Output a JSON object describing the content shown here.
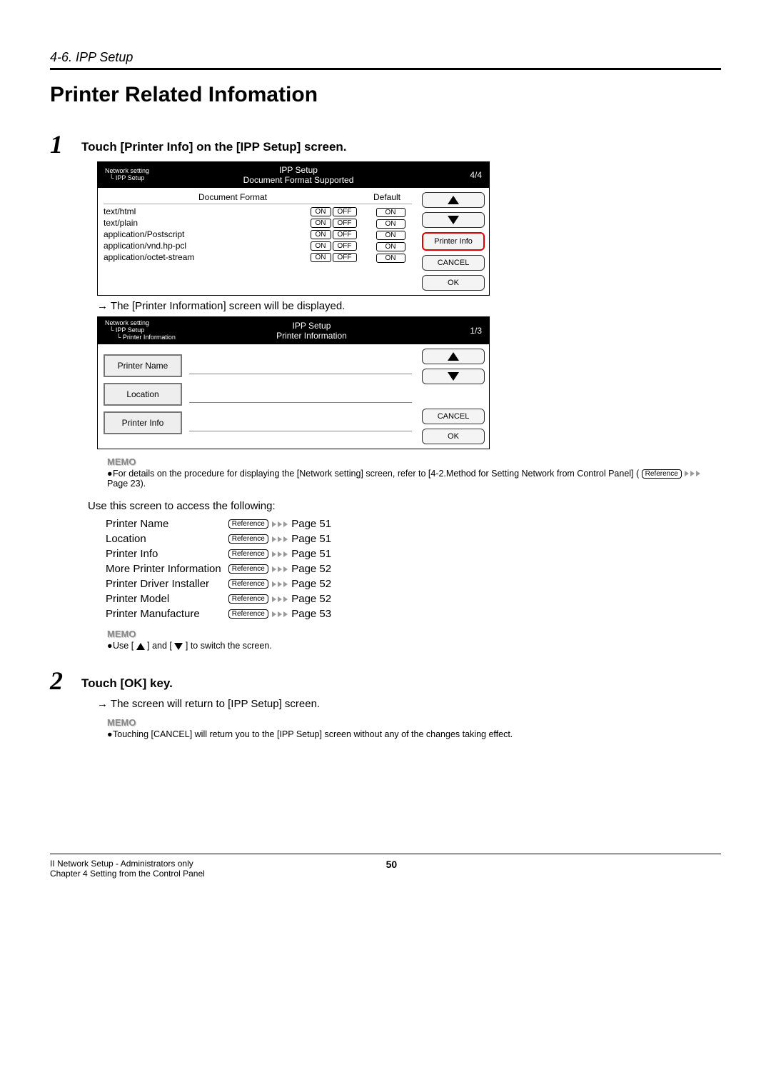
{
  "header": {
    "section": "4-6. IPP Setup"
  },
  "title": "Printer Related Infomation",
  "step1": {
    "num": "1",
    "head": "Touch [Printer Info] on the [IPP Setup] screen.",
    "result": "The [Printer Information] screen will be displayed."
  },
  "screenA": {
    "crumb1": "Network setting",
    "crumb2": "IPP Setup",
    "title1": "IPP Setup",
    "title2": "Document Format Supported",
    "page": "4/4",
    "col1": "Document Format",
    "col2": "Default",
    "rows": [
      {
        "label": "text/html",
        "on": "ON",
        "off": "OFF",
        "def": "ON"
      },
      {
        "label": "text/plain",
        "on": "ON",
        "off": "OFF",
        "def": "ON"
      },
      {
        "label": "application/Postscript",
        "on": "ON",
        "off": "OFF",
        "def": "ON"
      },
      {
        "label": "application/vnd.hp-pcl",
        "on": "ON",
        "off": "OFF",
        "def": "ON"
      },
      {
        "label": "application/octet-stream",
        "on": "ON",
        "off": "OFF",
        "def": "ON"
      }
    ],
    "side_printer_info": "Printer Info",
    "side_cancel": "CANCEL",
    "side_ok": "OK"
  },
  "screenB": {
    "crumb1": "Network setting",
    "crumb2": "IPP Setup",
    "crumb3": "Printer Information",
    "title1": "IPP Setup",
    "title2": "Printer Information",
    "page": "1/3",
    "f1": "Printer Name",
    "f2": "Location",
    "f3": "Printer Info",
    "side_cancel": "CANCEL",
    "side_ok": "OK"
  },
  "memo1": {
    "head": "MEMO",
    "body_a": "For details on the procedure for displaying the [Network setting] screen, refer to [4-2.Method for Setting Network from Control Panel] (",
    "ref": "Reference",
    "body_b": " Page 23)."
  },
  "lead": "Use this screen to access the following:",
  "refs": [
    {
      "label": "Printer Name",
      "page": "Page 51"
    },
    {
      "label": "Location",
      "page": "Page 51"
    },
    {
      "label": "Printer Info",
      "page": "Page 51"
    },
    {
      "label": "More Printer Information",
      "page": "Page 52"
    },
    {
      "label": "Printer Driver Installer",
      "page": "Page 52"
    },
    {
      "label": "Printer Model",
      "page": "Page 52"
    },
    {
      "label": "Printer Manufacture",
      "page": "Page 53"
    }
  ],
  "ref_badge": "Reference",
  "memo2": {
    "head": "MEMO",
    "body_a": "Use [",
    "body_b": "] and [",
    "body_c": "] to switch the screen."
  },
  "step2": {
    "num": "2",
    "head": "Touch [OK] key.",
    "result": "The screen will return to [IPP Setup] screen."
  },
  "memo3": {
    "head": "MEMO",
    "body": "Touching [CANCEL] will return you to the [IPP Setup] screen without any of the changes taking effect."
  },
  "footer": {
    "l1": "II Network Setup - Administrators only",
    "l2": "Chapter 4 Setting from the Control Panel",
    "page": "50"
  }
}
